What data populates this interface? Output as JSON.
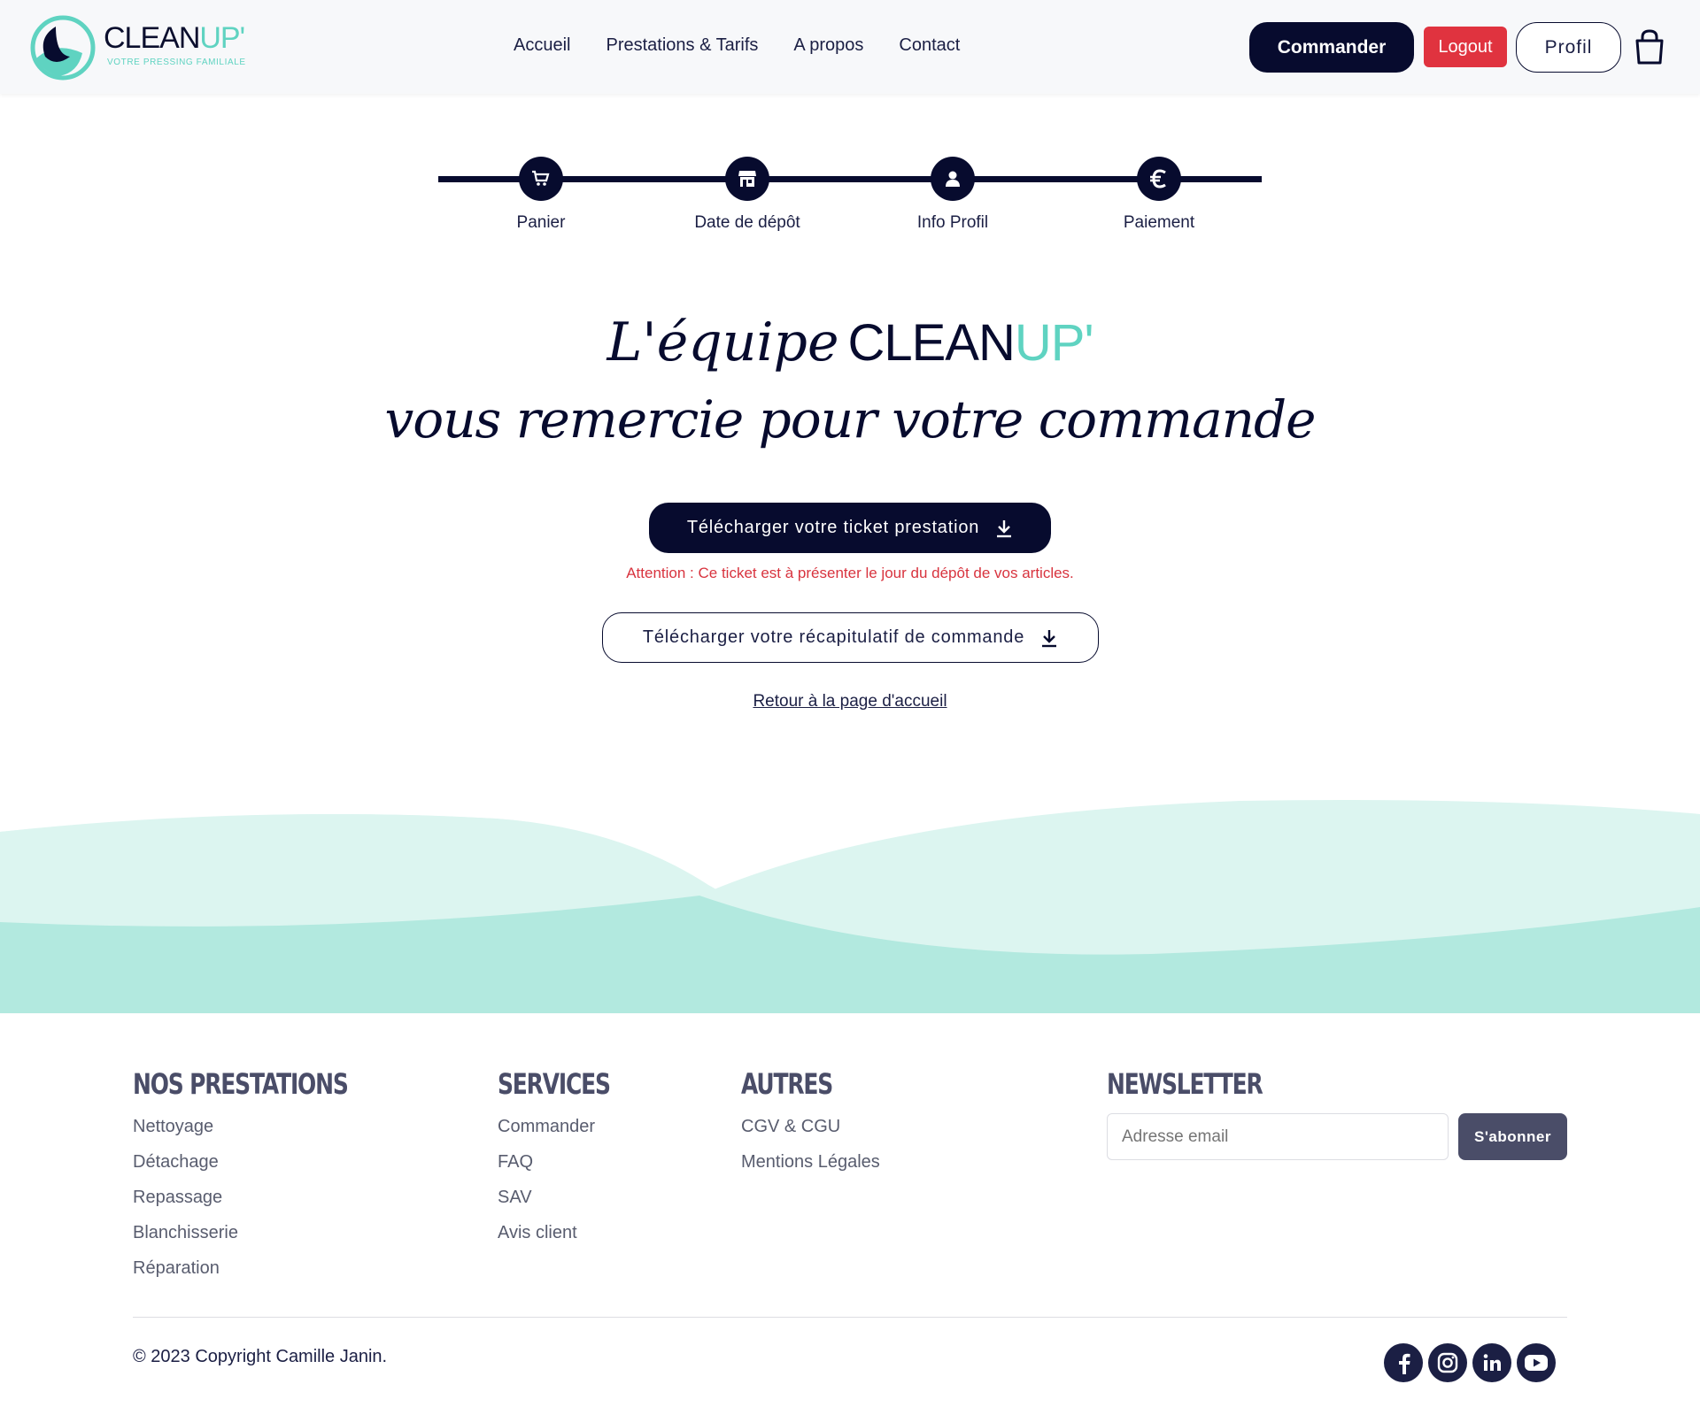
{
  "header": {
    "logo": {
      "text_main": "CLEAN",
      "text_accent": "UP'",
      "tagline": "VOTRE PRESSING FAMILIALE"
    },
    "nav": [
      "Accueil",
      "Prestations & Tarifs",
      "A propos",
      "Contact"
    ],
    "commander_label": "Commander",
    "logout_label": "Logout",
    "profil_label": "Profil"
  },
  "stepper": {
    "steps": [
      {
        "label": "Panier",
        "icon": "cart-icon"
      },
      {
        "label": "Date de dépôt",
        "icon": "store-icon"
      },
      {
        "label": "Info Profil",
        "icon": "user-icon"
      },
      {
        "label": "Paiement",
        "icon": "euro-icon"
      }
    ]
  },
  "main": {
    "thanks_line1_script": "L'équipe",
    "thanks_brand_main": "CLEAN",
    "thanks_brand_accent": "UP'",
    "thanks_line2": "vous remercie pour votre commande",
    "ticket_button": "Télécharger votre ticket prestation",
    "warning": "Attention : Ce ticket est à présenter le jour du dépôt de vos articles.",
    "recap_button": "Télécharger votre récapitulatif de commande",
    "back_link": "Retour à la page d'accueil"
  },
  "footer": {
    "prestations": {
      "title": "NOS PRESTATIONS",
      "items": [
        "Nettoyage",
        "Détachage",
        "Repassage",
        "Blanchisserie",
        "Réparation"
      ]
    },
    "services": {
      "title": "SERVICES",
      "items": [
        "Commander",
        "FAQ",
        "SAV",
        "Avis client"
      ]
    },
    "autres": {
      "title": "AUTRES",
      "items": [
        "CGV & CGU",
        "Mentions Légales"
      ]
    },
    "newsletter": {
      "title": "NEWSLETTER",
      "placeholder": "Adresse email",
      "button": "S'abonner"
    },
    "copyright": "© 2023 Copyright Camille Janin.",
    "socials": [
      "facebook-icon",
      "instagram-icon",
      "linkedin-icon",
      "youtube-icon"
    ]
  },
  "colors": {
    "navy": "#070b2e",
    "teal": "#5fd3c1",
    "red": "#e0333f",
    "wave_light": "#dcf5f0",
    "wave_dark": "#b2e9df"
  }
}
